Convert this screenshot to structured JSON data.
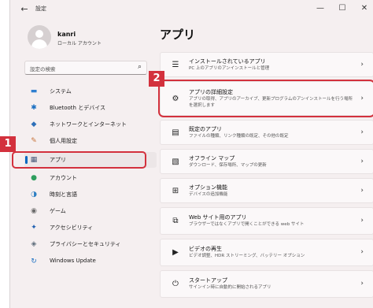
{
  "window": {
    "title": "設定",
    "back_icon": "←",
    "min_icon": "—",
    "max_icon": "☐",
    "close_icon": "✕"
  },
  "profile": {
    "name": "kanri",
    "account_type": "ローカル アカウント"
  },
  "search": {
    "placeholder": "設定の検索",
    "icon": "⌕"
  },
  "sidebar": {
    "items": [
      {
        "label": "システム",
        "icon": "▬",
        "color": "#2f7fd0"
      },
      {
        "label": "Bluetooth とデバイス",
        "icon": "✱",
        "color": "#1a6fc2"
      },
      {
        "label": "ネットワークとインターネット",
        "icon": "◆",
        "color": "#2d6fb8"
      },
      {
        "label": "個人用設定",
        "icon": "✎",
        "color": "#c8743a"
      },
      {
        "label": "アプリ",
        "icon": "▦",
        "color": "#4a5a7a"
      },
      {
        "label": "アカウント",
        "icon": "●",
        "color": "#2f9e5e"
      },
      {
        "label": "時刻と言語",
        "icon": "◑",
        "color": "#2d7ec2"
      },
      {
        "label": "ゲーム",
        "icon": "◉",
        "color": "#6b6b6b"
      },
      {
        "label": "アクセシビリティ",
        "icon": "✦",
        "color": "#2060b0"
      },
      {
        "label": "プライバシーとセキュリティ",
        "icon": "◈",
        "color": "#5d6c7a"
      },
      {
        "label": "Windows Update",
        "icon": "↻",
        "color": "#1a6fc2"
      }
    ],
    "active_index": 4
  },
  "main": {
    "title": "アプリ",
    "cards": [
      {
        "title": "インストールされているアプリ",
        "sub": "PC 上のアプリのアンインストールと管理",
        "icon": "☰"
      },
      {
        "title": "アプリの詳細設定",
        "sub": "アプリの取得、アプリのアーカイブ、更新プログラムのアンインストールを行う場所を選択します",
        "icon": "⚙"
      },
      {
        "title": "既定のアプリ",
        "sub": "ファイルの種類、リンク種類の既定、その他の既定",
        "icon": "▤"
      },
      {
        "title": "オフライン マップ",
        "sub": "ダウンロード、保存場所、マップの更新",
        "icon": "▧"
      },
      {
        "title": "オプション機能",
        "sub": "デバイスの追加機能",
        "icon": "⊞"
      },
      {
        "title": "Web サイト用のアプリ",
        "sub": "ブラウザーではなくアプリで開くことができる web サイト",
        "icon": "⧉"
      },
      {
        "title": "ビデオの再生",
        "sub": "ビデオ調整、HDR ストリーミング、バッテリー オプション",
        "icon": "▶"
      },
      {
        "title": "スタートアップ",
        "sub": "サインイン時に自動的に開始されるアプリ",
        "icon": "⏻"
      }
    ],
    "chevron": "›"
  },
  "annotations": {
    "badge1": "1",
    "badge2": "2",
    "accent": "#d3313d"
  }
}
